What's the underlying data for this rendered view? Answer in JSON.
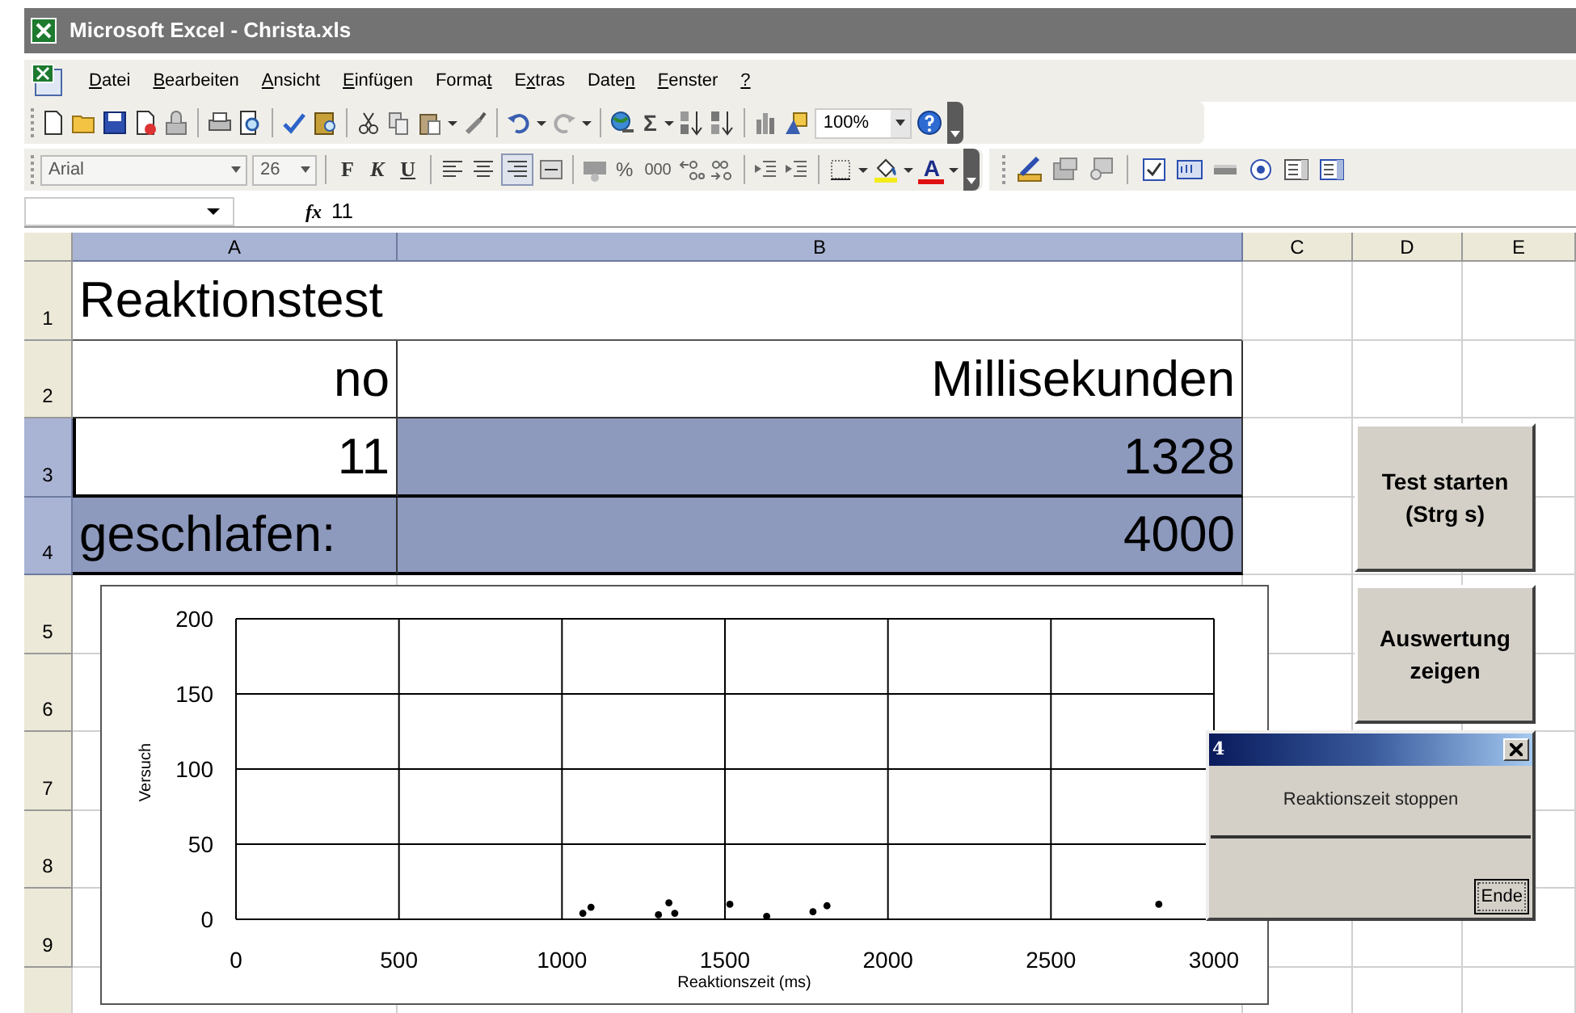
{
  "window": {
    "title": "Microsoft Excel - Christa.xls"
  },
  "menu": [
    {
      "key": "D",
      "rest": "atei"
    },
    {
      "key": "B",
      "rest": "earbeiten"
    },
    {
      "key": "A",
      "rest": "nsicht"
    },
    {
      "key": "E",
      "rest": "infügen"
    },
    {
      "lead": "Forma",
      "key": "t"
    },
    {
      "lead": "E",
      "key": "x",
      "rest": "tras"
    },
    {
      "lead": "Date",
      "key": "n"
    },
    {
      "key": "F",
      "rest": "enster"
    },
    {
      "key": "?"
    }
  ],
  "standard_toolbar": {
    "sum": "Σ",
    "zoom": "100%"
  },
  "formatting_toolbar": {
    "font": "Arial",
    "size": "26",
    "styles": [
      "F",
      "K",
      "U"
    ],
    "percent": "%",
    "thousands": "000",
    "font_color": "A"
  },
  "formula_bar": {
    "function_label": "fx",
    "value": "11"
  },
  "columns": [
    {
      "label": "A",
      "selected": true
    },
    {
      "label": "B",
      "selected": true
    },
    {
      "label": "C",
      "selected": false
    },
    {
      "label": "D",
      "selected": false
    },
    {
      "label": "E",
      "selected": false
    }
  ],
  "rows": [
    {
      "label": "1",
      "selected": false,
      "cells": [
        {
          "text": "Reaktionstest",
          "kind": "title",
          "selected": false,
          "active": false
        }
      ]
    },
    {
      "label": "2",
      "selected": false,
      "cells": [
        {
          "text": "no",
          "kind": "value",
          "selected": false,
          "active": false
        },
        {
          "text": "Millisekunden",
          "kind": "value",
          "selected": false,
          "active": false
        }
      ]
    },
    {
      "label": "3",
      "selected": true,
      "cells": [
        {
          "text": "11",
          "kind": "value",
          "selected": true,
          "active": true
        },
        {
          "text": "1328",
          "kind": "value",
          "selected": true,
          "active": false
        }
      ]
    },
    {
      "label": "4",
      "selected": true,
      "cells": [
        {
          "text": "geschlafen:",
          "kind": "title",
          "selected": true,
          "active": false
        },
        {
          "text": "4000",
          "kind": "value",
          "selected": true,
          "active": false
        }
      ]
    },
    {
      "label": "5",
      "selected": false,
      "cells": []
    },
    {
      "label": "6",
      "selected": false,
      "cells": []
    },
    {
      "label": "7",
      "selected": false,
      "cells": []
    },
    {
      "label": "8",
      "selected": false,
      "cells": []
    },
    {
      "label": "9",
      "selected": false,
      "cells": []
    }
  ],
  "buttons": [
    {
      "lines": [
        "Test starten",
        "(Strg s)"
      ]
    },
    {
      "lines": [
        "Auswertung",
        "zeigen"
      ]
    }
  ],
  "chart": {
    "chart_data": {
      "type": "scatter",
      "xlabel": "Reaktionszeit (ms)",
      "ylabel": "Versuch",
      "x": [
        1064,
        1089,
        1296,
        1328,
        1346,
        1515,
        1628,
        1770,
        1813,
        2831
      ],
      "grid": true,
      "series": [
        {
          "color": "#000000",
          "values": [
            4,
            8,
            3,
            11,
            4,
            10,
            2,
            5,
            9,
            10
          ]
        }
      ],
      "xlim": [
        0,
        3000
      ],
      "ylim": [
        0,
        200
      ],
      "xticks": [
        0,
        500,
        1000,
        1500,
        2000,
        2500,
        3000
      ],
      "yticks": [
        0,
        50,
        100,
        150,
        200
      ]
    }
  },
  "dialog": {
    "title": "4",
    "message": "Reaktionszeit stoppen",
    "button": "Ende"
  }
}
